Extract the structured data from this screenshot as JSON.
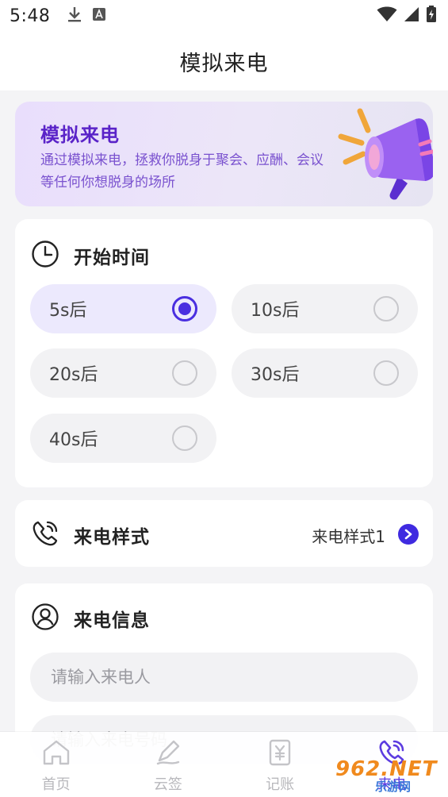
{
  "status_bar": {
    "time": "5:48",
    "icons": [
      "download-icon",
      "a-icon",
      "wifi-icon",
      "signal-icon",
      "battery-icon"
    ]
  },
  "app_bar": {
    "title": "模拟来电"
  },
  "banner": {
    "title": "模拟来电",
    "description": "通过模拟来电，拯救你脱身于聚会、应酬、会议等任何你想脱身的场所",
    "illustration": "megaphone-illustration"
  },
  "start_time": {
    "title": "开始时间",
    "icon": "clock-icon",
    "options": [
      {
        "label": "5s后",
        "selected": true
      },
      {
        "label": "10s后",
        "selected": false
      },
      {
        "label": "20s后",
        "selected": false
      },
      {
        "label": "30s后",
        "selected": false
      },
      {
        "label": "40s后",
        "selected": false
      }
    ]
  },
  "call_style": {
    "title": "来电样式",
    "icon": "phone-ringing-icon",
    "value": "来电样式1",
    "arrow_icon": "chevron-right-icon"
  },
  "call_info": {
    "title": "来电信息",
    "icon": "user-icon",
    "caller_placeholder": "请输入来电人",
    "number_placeholder": "请输入来电号码"
  },
  "tabbar": {
    "items": [
      {
        "label": "首页",
        "icon": "home-icon",
        "active": false
      },
      {
        "label": "云签",
        "icon": "pen-icon",
        "active": false
      },
      {
        "label": "记账",
        "icon": "ledger-icon",
        "active": false
      },
      {
        "label": "来电",
        "icon": "phone-ringing-icon",
        "active": true
      }
    ]
  },
  "watermark": {
    "top": "962.NET",
    "bottom": "乐游网"
  },
  "colors": {
    "accent": "#4a2fe0",
    "banner_title": "#5a23c8",
    "background": "#f4f4f6"
  }
}
